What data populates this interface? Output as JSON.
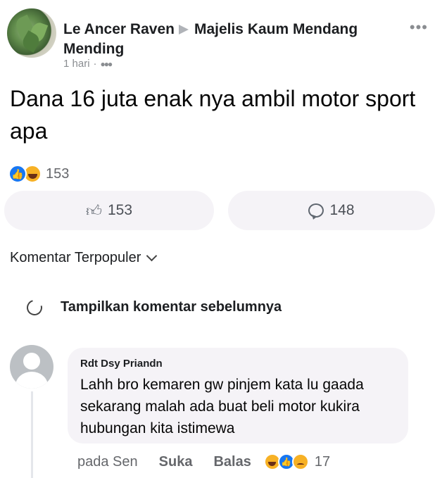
{
  "post": {
    "author": "Le Ancer Raven",
    "group": "Majelis Kaum Mendang Mending",
    "time": "1 hari",
    "separator": "·",
    "text": "Dana 16 juta enak nya ambil motor sport apa",
    "reaction_count": "153"
  },
  "actions": {
    "like_count": "153",
    "comment_count": "148"
  },
  "comments": {
    "sort_label": "Komentar Terpopuler",
    "previous_label": "Tampilkan komentar sebelumnya",
    "items": [
      {
        "author": "Rdt Dsy Priandn",
        "text": "Lahh bro kemaren gw pinjem kata lu gaada sekarang malah ada buat beli motor kukira hubungan kita istimewa",
        "time": "pada Sen",
        "like_label": "Suka",
        "reply_label": "Balas",
        "reaction_count": "17"
      }
    ]
  },
  "colors": {
    "like_blue": "#1877f2",
    "haha_yellow": "#f7b125",
    "bubble_bg": "#f5f3f7",
    "muted_text": "#65676b"
  },
  "icons": [
    "more-icon",
    "group-privacy-icon",
    "like-reaction-icon",
    "haha-reaction-icon",
    "sad-reaction-icon",
    "thumbs-up-icon",
    "comment-icon",
    "chevron-down-icon",
    "refresh-icon"
  ]
}
